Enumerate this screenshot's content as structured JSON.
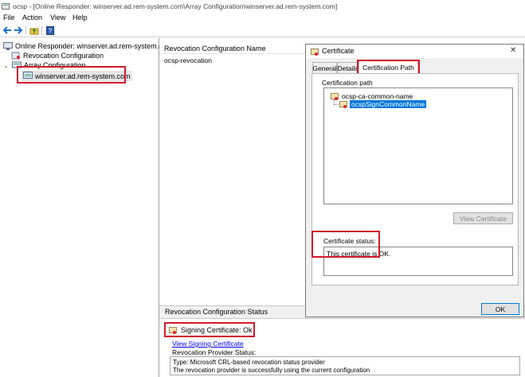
{
  "window": {
    "title": "ocsp - [Online Responder: winserver.ad.rem-system.com\\Array Configuration\\winserver.ad.rem-system.com]"
  },
  "menu": [
    "File",
    "Action",
    "View",
    "Help"
  ],
  "tree": {
    "root": "Online Responder: winserver.ad.rem-system.com",
    "revocation": "Revocation Configuration",
    "array": "Array Configuration",
    "member": "winserver.ad.rem-system.com"
  },
  "right": {
    "col_header": "Revocation Configuration Name",
    "row1": "ocsp-revocation",
    "status_header": "Revocation Configuration Status",
    "signing": "Signing Certificate: Ok",
    "view_link": "View Signing Certificate",
    "provider_label": "Revocation Provider Status:",
    "provider_line1": "Type: Microsoft CRL-based revocation status provider",
    "provider_line2": "The revocation provider is successfully using the current configuration"
  },
  "dialog": {
    "title": "Certificate",
    "close": "✕",
    "tabs": [
      "General",
      "Details",
      "Certification Path"
    ],
    "path_label": "Certification path",
    "path_root": "ocsp-ca-common-name",
    "path_leaf": "ocspSignCommonName",
    "view_cert_btn": "View Certificate",
    "status_label": "Certificate status:",
    "status_text": "This certificate is OK.",
    "ok_btn": "OK"
  },
  "colors": {
    "highlight": "#d11a2a",
    "selection": "#0078d7",
    "link": "#0000ee"
  }
}
